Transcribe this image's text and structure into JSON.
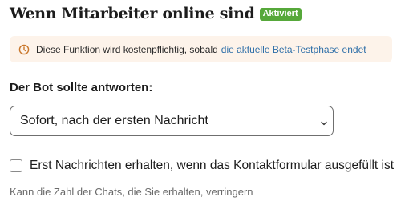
{
  "header": {
    "title": "Wenn Mitarbeiter online sind",
    "badge": "Aktiviert"
  },
  "notice": {
    "icon": "clock-icon",
    "text": "Diese Funktion wird kostenpflichtig, sobald",
    "link_text": "die aktuelle Beta-Testphase endet"
  },
  "response": {
    "label": "Der Bot sollte antworten:",
    "selected_option": "Sofort, nach der ersten Nachricht",
    "dropdown_icon": "chevron-down-icon"
  },
  "contact_form": {
    "checkbox_label": "Erst Nachrichten erhalten, wenn das Kontaktformular ausgefüllt ist",
    "checked": false,
    "hint": "Kann die Zahl der Chats, die Sie erhalten, verringern"
  },
  "colors": {
    "badge_background": "#56a83a",
    "notice_background": "#fdf3ea",
    "notice_icon": "#c9772b",
    "link": "#2e6fa8"
  }
}
